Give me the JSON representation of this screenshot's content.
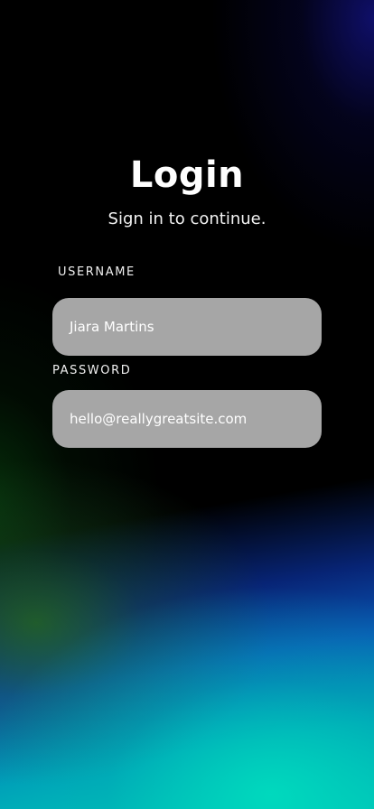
{
  "header": {
    "title": "Login",
    "subtitle": "Sign in to continue."
  },
  "form": {
    "username": {
      "label": "USERNAME",
      "value": "Jiara Martins"
    },
    "password": {
      "label": "PASSWORD",
      "value": "hello@reallygreatsite.com"
    }
  },
  "colors": {
    "background": "#000000",
    "field_fill": "#a6a6a6",
    "text": "#ffffff",
    "gradient_blue": "#0a5abe",
    "gradient_teal": "#00cdb9",
    "gradient_green": "#286e14"
  }
}
